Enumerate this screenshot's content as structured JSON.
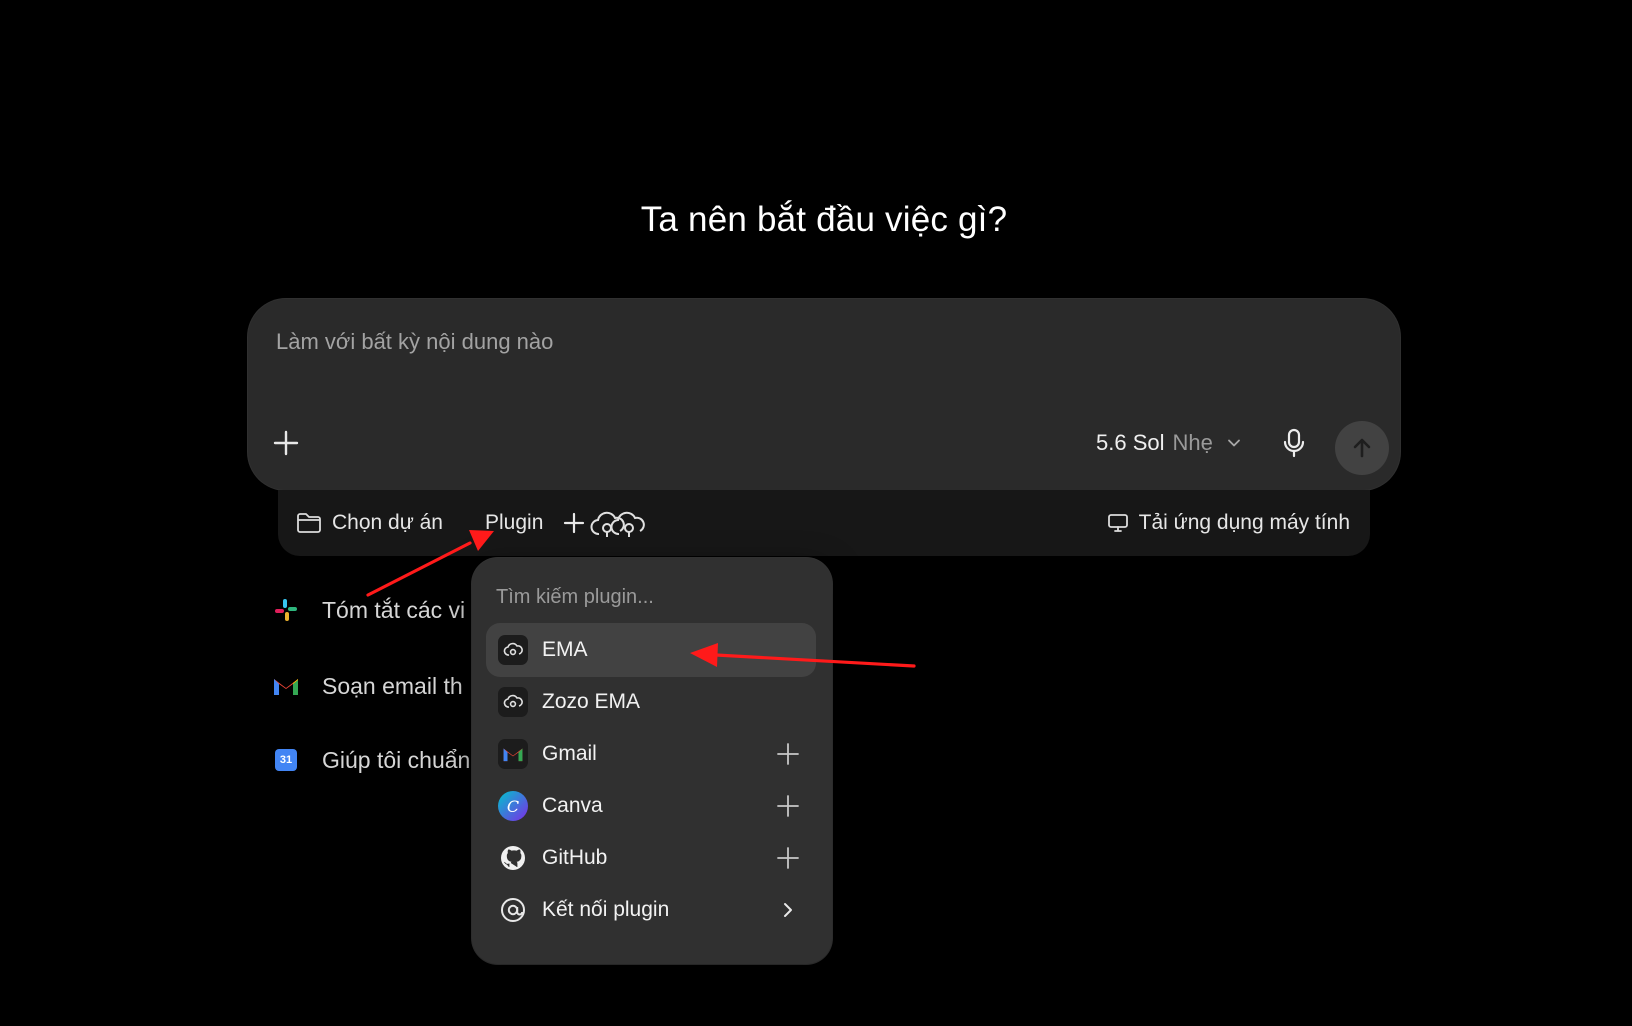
{
  "heading": "Ta nên bắt đầu việc gì?",
  "composer": {
    "placeholder": "Làm với bất kỳ nội dung nào",
    "model_name": "5.6 Sol",
    "model_mode": "Nhẹ"
  },
  "toolbar": {
    "project_label": "Chọn dự án",
    "plugin_label": "Plugin",
    "desktop_label": "Tải ứng dụng máy tính"
  },
  "suggestions": [
    {
      "label": "Tóm tắt các vi",
      "icon": "slack-icon"
    },
    {
      "label": "Soạn email th",
      "icon": "gmail-icon"
    },
    {
      "label": "Giúp tôi chuẩn",
      "icon": "calendar-icon",
      "icon_text": "31"
    }
  ],
  "plugin_menu": {
    "search_placeholder": "Tìm kiếm plugin...",
    "items": [
      {
        "label": "EMA",
        "icon": "cloud-plugin-icon",
        "active": true
      },
      {
        "label": "Zozo EMA",
        "icon": "cloud-plugin-icon"
      },
      {
        "label": "Gmail",
        "icon": "gmail-icon",
        "trail": "plus-icon"
      },
      {
        "label": "Canva",
        "icon": "canva-icon",
        "icon_text": "C",
        "trail": "plus-icon"
      },
      {
        "label": "GitHub",
        "icon": "github-icon",
        "trail": "plus-icon"
      },
      {
        "label": "Kết nối plugin",
        "icon": "at-sign-icon",
        "trail": "chevron-right-icon"
      }
    ]
  },
  "colors": {
    "background": "#000000",
    "composer": "#2a2a2a",
    "menu": "#303030",
    "annotation_arrow": "#ff1a1a"
  }
}
